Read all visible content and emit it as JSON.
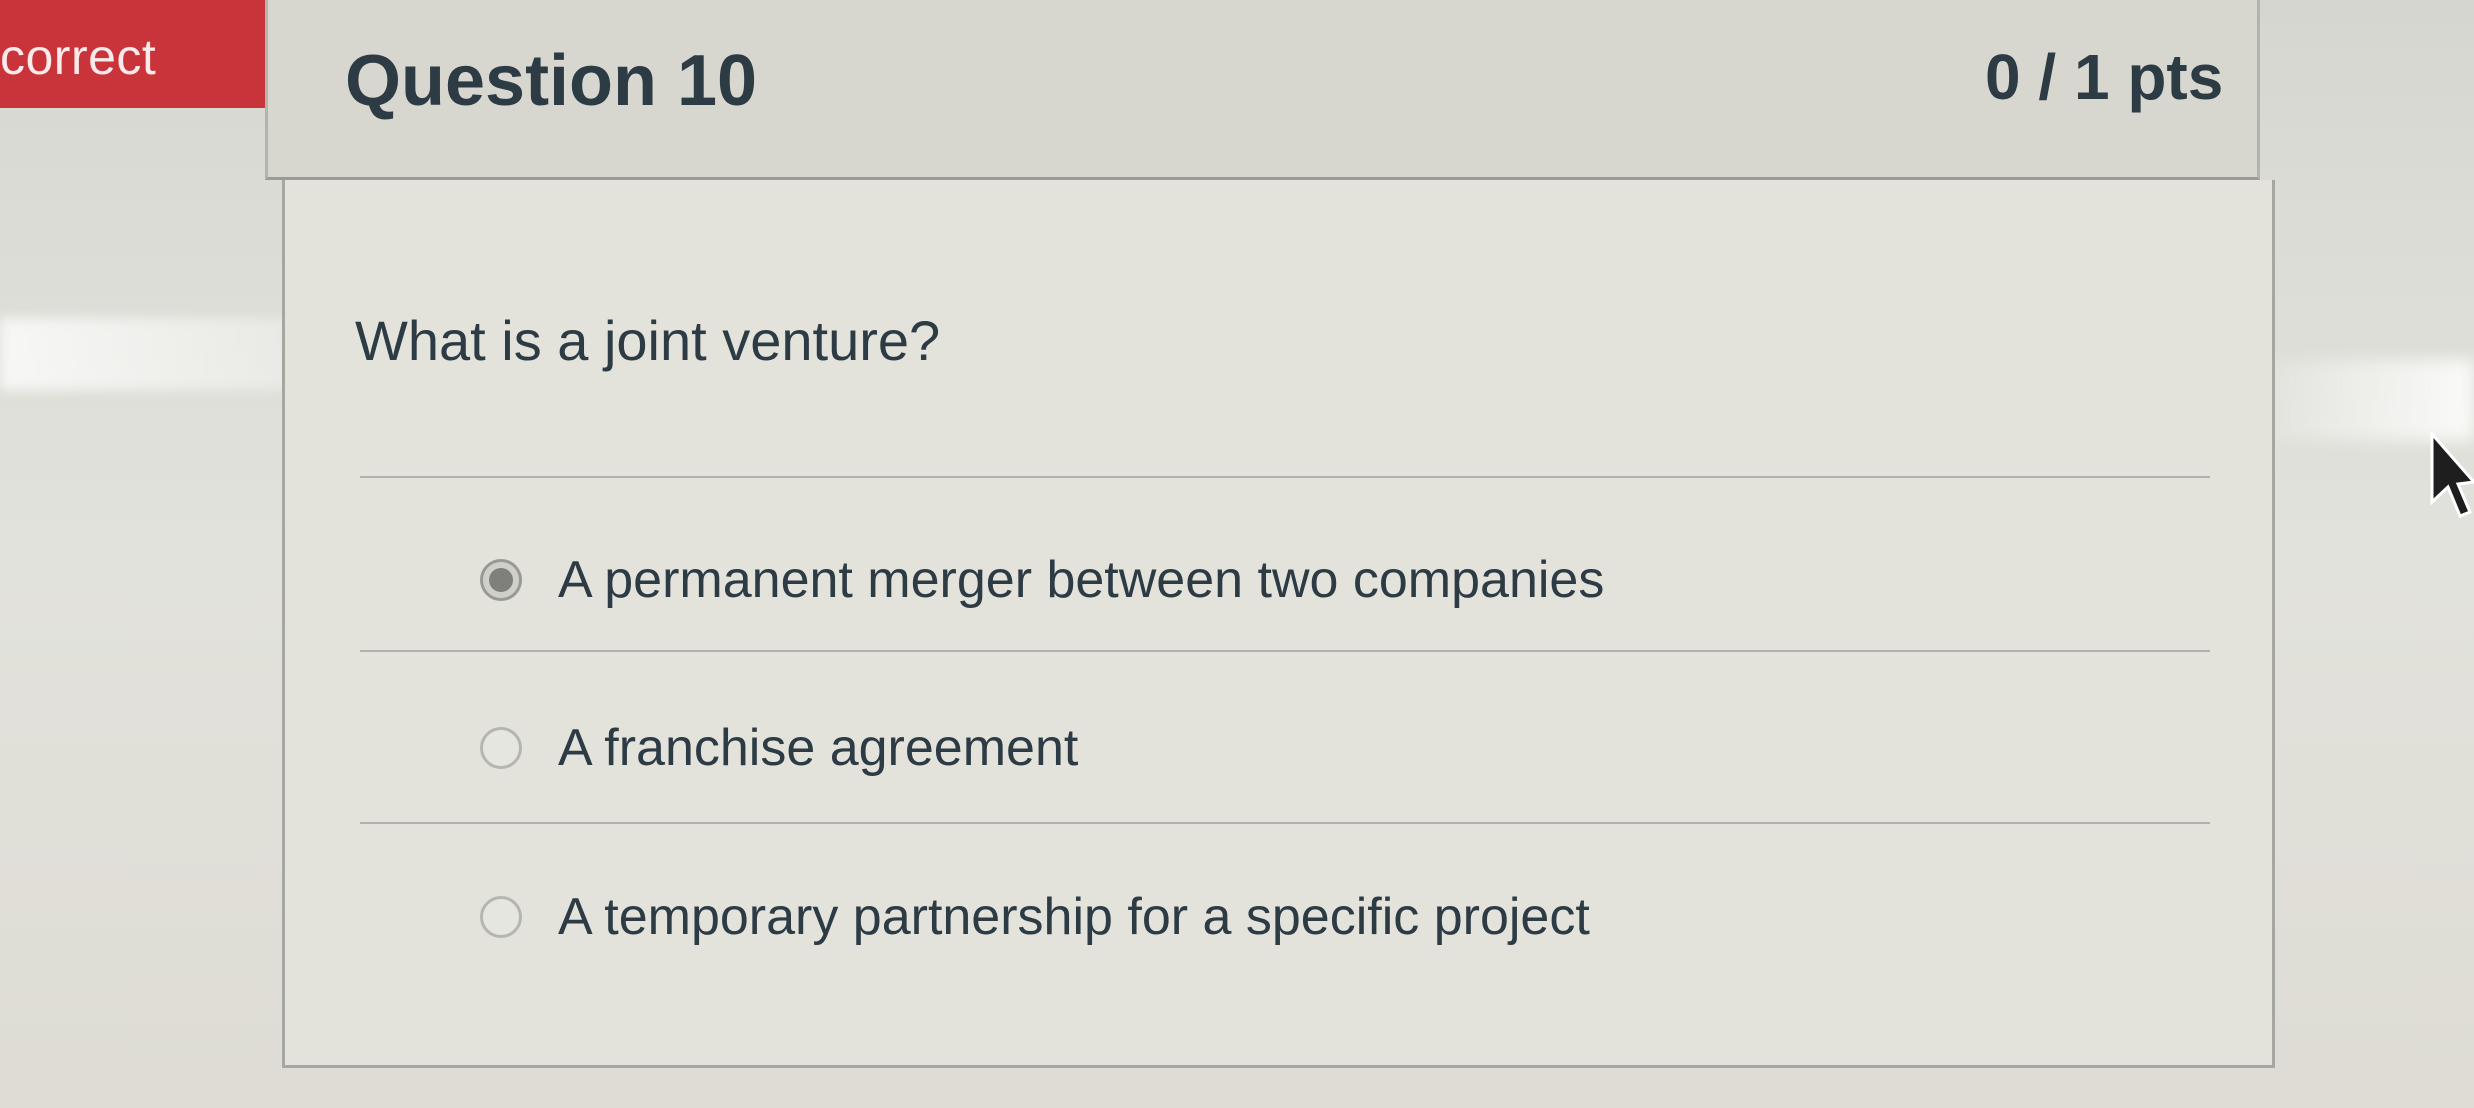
{
  "ribbon": {
    "label": "correct",
    "color": "#c9333a"
  },
  "question": {
    "title": "Question 10",
    "points": "0 / 1 pts",
    "prompt": "What is a joint venture?"
  },
  "answers": [
    {
      "label": "A permanent merger between two companies",
      "selected": true
    },
    {
      "label": "A franchise agreement",
      "selected": false
    },
    {
      "label": "A temporary partnership for a specific project",
      "selected": false
    }
  ],
  "icons": {
    "cursor": "mouse-pointer-icon",
    "radio": "radio-button-icon"
  }
}
